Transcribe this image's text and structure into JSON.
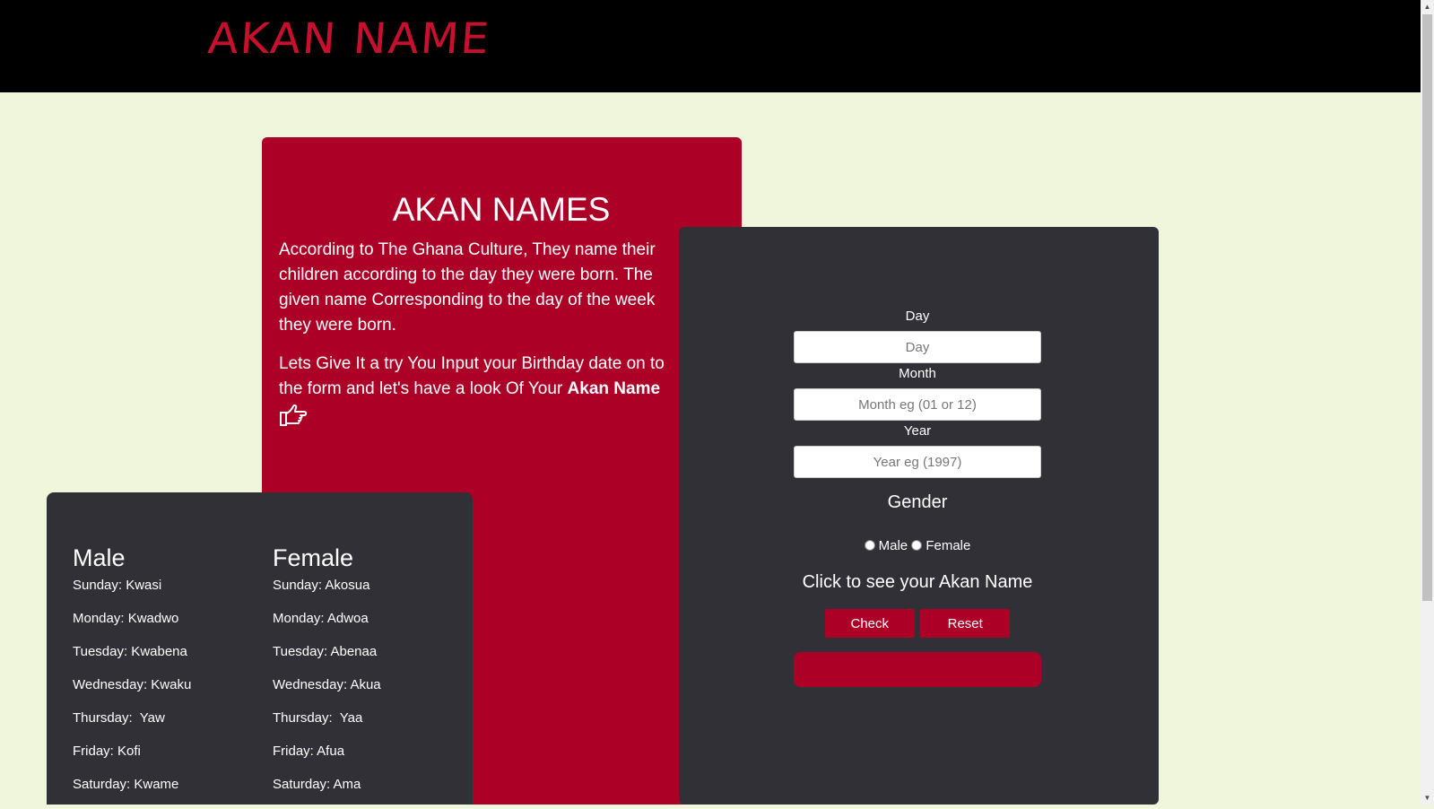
{
  "header": {
    "logo_text": "AKAN NAME"
  },
  "intro": {
    "title": "AKAN NAMES",
    "paragraph1": "According to The Ghana Culture, They name their children according to the day they were born. The given name Corresponding to the day of the week they were born.",
    "paragraph2_text": "Lets Give It a try You Input your Birthday date on to the form and let's have a look Of Your ",
    "paragraph2_bold": "Akan Name",
    "icon": "hand-pointing-right-icon"
  },
  "names": {
    "male": {
      "heading": "Male",
      "items": [
        "Sunday: Kwasi",
        "Monday: Kwadwo",
        "Tuesday: Kwabena",
        "Wednesday: Kwaku",
        "Thursday:  Yaw",
        "Friday: Kofi",
        "Saturday: Kwame"
      ]
    },
    "female": {
      "heading": "Female",
      "items": [
        "Sunday: Akosua",
        "Monday: Adwoa",
        "Tuesday: Abenaa",
        "Wednesday: Akua",
        "Thursday:  Yaa",
        "Friday: Afua",
        "Saturday: Ama"
      ]
    }
  },
  "form": {
    "day_label": "Day",
    "day_placeholder": "Day",
    "month_label": "Month",
    "month_placeholder": "Month eg (01 or 12)",
    "year_label": "Year",
    "year_placeholder": "Year eg (1997)",
    "gender_title": "Gender",
    "male_label": "Male",
    "female_label": "Female",
    "click_text": "Click to see your Akan Name",
    "check_label": "Check",
    "reset_label": "Reset",
    "result_text": ""
  },
  "colors": {
    "background": "#f0f6dc",
    "header": "#000000",
    "accent_red": "#ad0026",
    "card_dark": "#303036",
    "logo_red": "#c8102e"
  }
}
